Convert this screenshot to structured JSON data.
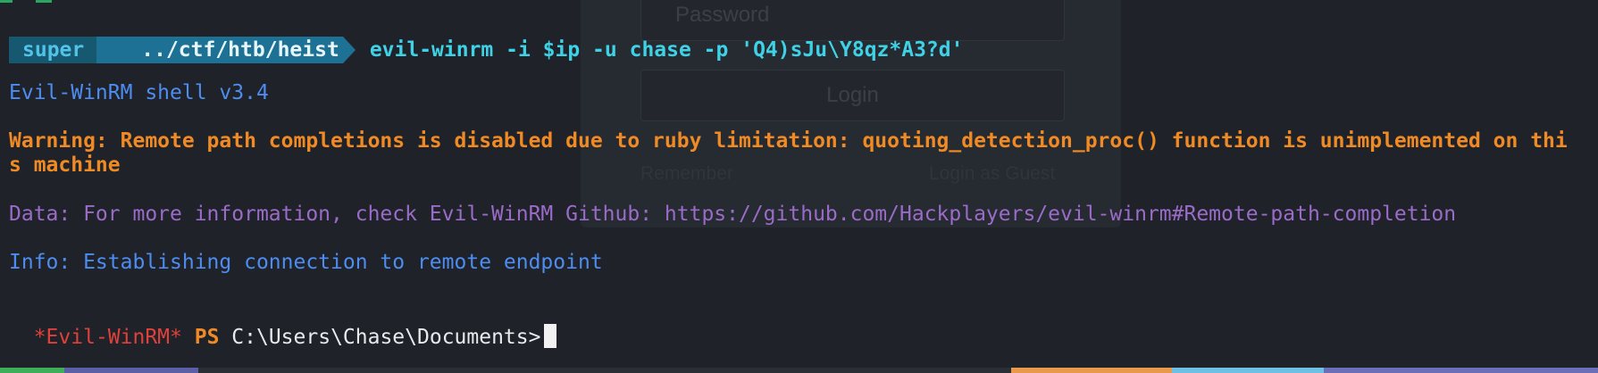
{
  "background_form": {
    "password_placeholder": "Password",
    "login_label": "Login",
    "remember_label": "Remember",
    "guest_label": "Login as Guest"
  },
  "prompt": {
    "user": "super",
    "path": "../ctf/htb/heist",
    "command": "evil-winrm -i $ip -u chase -p 'Q4)sJu\\Y8qz*A3?d'"
  },
  "output": {
    "banner": "Evil-WinRM shell v3.4",
    "warning_line1": "Warning: Remote path completions is disabled due to ruby limitation: quoting_detection_proc() function is unimplemented on thi",
    "warning_line2": "s machine",
    "data_line": "Data: For more information, check Evil-WinRM Github: https://github.com/Hackplayers/evil-winrm#Remote-path-completion",
    "info_line": "Info: Establishing connection to remote endpoint"
  },
  "shell_prompt": {
    "tag": "*Evil-WinRM*",
    "ps": "PS",
    "cwd": "C:\\Users\\Chase\\Documents>"
  },
  "colors": {
    "background": "#1f2329",
    "prompt_user_bg": "#16586f",
    "prompt_path_bg": "#1c7195",
    "command": "#3fd2e6",
    "info_blue": "#4d8cf0",
    "warning_orange": "#f08a24",
    "data_purple": "#9b6bc9",
    "evil_red": "#e0403a"
  }
}
